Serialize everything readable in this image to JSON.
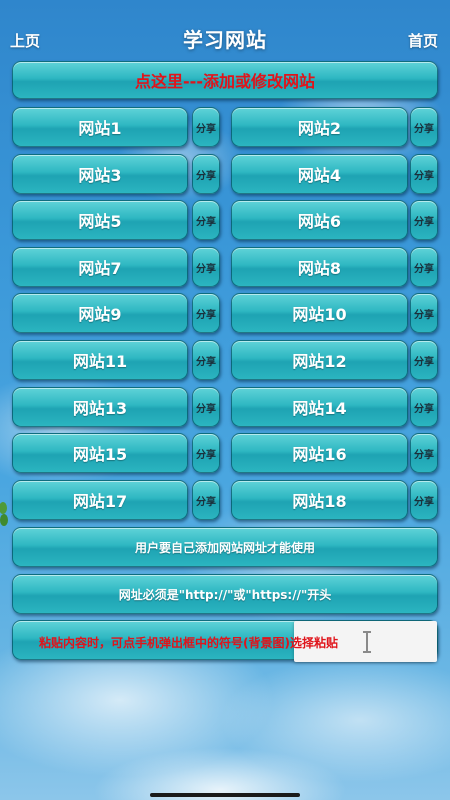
{
  "header": {
    "prev_label": "上页",
    "title": "学习网站",
    "home_label": "首页"
  },
  "add_button_label": "点这里---添加或修改网站",
  "sites": [
    {
      "label": "网站1",
      "share": "分享"
    },
    {
      "label": "网站2",
      "share": "分享"
    },
    {
      "label": "网站3",
      "share": "分享"
    },
    {
      "label": "网站4",
      "share": "分享"
    },
    {
      "label": "网站5",
      "share": "分享"
    },
    {
      "label": "网站6",
      "share": "分享"
    },
    {
      "label": "网站7",
      "share": "分享"
    },
    {
      "label": "网站8",
      "share": "分享"
    },
    {
      "label": "网站9",
      "share": "分享"
    },
    {
      "label": "网站10",
      "share": "分享"
    },
    {
      "label": "网站11",
      "share": "分享"
    },
    {
      "label": "网站12",
      "share": "分享"
    },
    {
      "label": "网站13",
      "share": "分享"
    },
    {
      "label": "网站14",
      "share": "分享"
    },
    {
      "label": "网站15",
      "share": "分享"
    },
    {
      "label": "网站16",
      "share": "分享"
    },
    {
      "label": "网站17",
      "share": "分享"
    },
    {
      "label": "网站18",
      "share": "分享"
    }
  ],
  "info": {
    "user_add_note": "用户要自己添加网站网址才能使用",
    "url_prefix_note": "网址必须是\"http://\"或\"https://\"开头",
    "paste_tip": "粘贴内容时，可点手机弹出框中的符号(背景图)选择粘贴"
  },
  "colors": {
    "accent_red": "#e0141b",
    "button_teal": "#2eb7c2",
    "sky_blue": "#3a97d8"
  }
}
